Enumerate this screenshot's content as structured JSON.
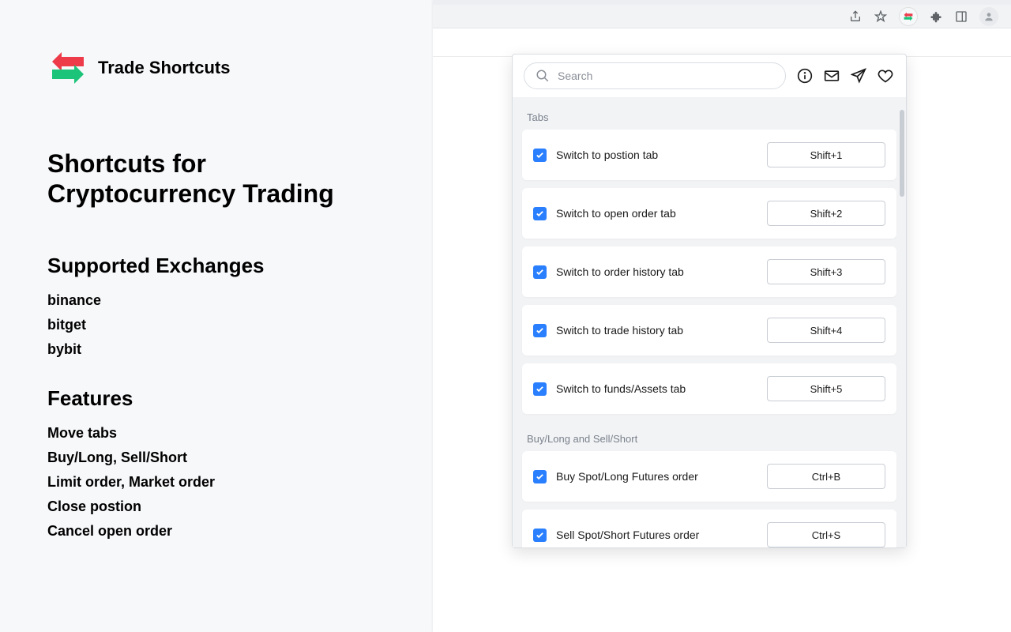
{
  "brand": {
    "name": "Trade Shortcuts"
  },
  "headline": "Shortcuts for Cryptocurrency Trading",
  "supported": {
    "title": "Supported Exchanges",
    "items": [
      "binance",
      "bitget",
      "bybit"
    ]
  },
  "features": {
    "title": "Features",
    "items": [
      "Move tabs",
      "Buy/Long, Sell/Short",
      "Limit order, Market order",
      "Close postion",
      "Cancel open order"
    ]
  },
  "popup": {
    "search_placeholder": "Search",
    "groups": [
      {
        "label": "Tabs",
        "items": [
          {
            "label": "Switch to postion tab",
            "key": "Shift+1",
            "checked": true
          },
          {
            "label": "Switch to open order tab",
            "key": "Shift+2",
            "checked": true
          },
          {
            "label": "Switch to order history tab",
            "key": "Shift+3",
            "checked": true
          },
          {
            "label": "Switch to trade history tab",
            "key": "Shift+4",
            "checked": true
          },
          {
            "label": "Switch to funds/Assets tab",
            "key": "Shift+5",
            "checked": true
          }
        ]
      },
      {
        "label": "Buy/Long and Sell/Short",
        "items": [
          {
            "label": "Buy Spot/Long Futures order",
            "key": "Ctrl+B",
            "checked": true
          },
          {
            "label": "Sell Spot/Short Futures order",
            "key": "Ctrl+S",
            "checked": true
          }
        ]
      }
    ]
  }
}
